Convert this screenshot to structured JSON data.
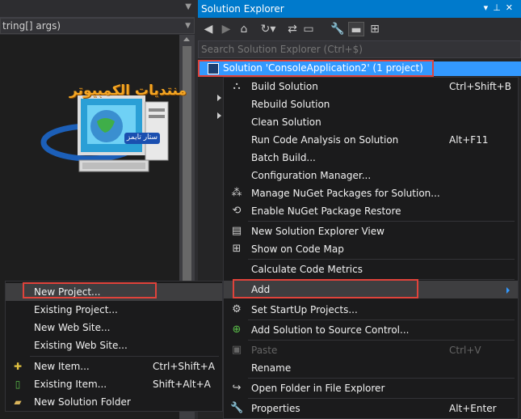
{
  "editor": {
    "nav_text": "tring[] args)"
  },
  "watermark": {
    "arabic_text": "منتديات الكمبيوتر",
    "badge_text": "ستار تايمز"
  },
  "solution_explorer": {
    "title": "Solution Explorer",
    "search_placeholder": "Search Solution Explorer (Ctrl+$)",
    "solution_label": "Solution 'ConsoleApplication2' (1 project)"
  },
  "context_menu": {
    "items": [
      {
        "label": "Build Solution",
        "shortcut": "Ctrl+Shift+B",
        "icon": "build-icon"
      },
      {
        "label": "Rebuild Solution",
        "shortcut": ""
      },
      {
        "label": "Clean Solution",
        "shortcut": ""
      },
      {
        "label": "Run Code Analysis on Solution",
        "shortcut": "Alt+F11"
      },
      {
        "label": "Batch Build...",
        "shortcut": ""
      },
      {
        "label": "Configuration Manager...",
        "shortcut": ""
      },
      {
        "label": "Manage NuGet Packages for Solution...",
        "shortcut": "",
        "icon": "nuget-icon"
      },
      {
        "label": "Enable NuGet Package Restore",
        "shortcut": "",
        "icon": "package-restore-icon"
      },
      {
        "label": "New Solution Explorer View",
        "shortcut": "",
        "icon": "new-view-icon"
      },
      {
        "label": "Show on Code Map",
        "shortcut": "",
        "icon": "code-map-icon"
      },
      {
        "label": "Calculate Code Metrics",
        "shortcut": ""
      },
      {
        "label": "Add",
        "shortcut": ""
      },
      {
        "label": "Set StartUp Projects...",
        "shortcut": "",
        "icon": "gear-icon"
      },
      {
        "label": "Add Solution to Source Control...",
        "shortcut": "",
        "icon": "source-control-icon"
      },
      {
        "label": "Paste",
        "shortcut": "Ctrl+V",
        "icon": "paste-icon",
        "disabled": true
      },
      {
        "label": "Rename",
        "shortcut": ""
      },
      {
        "label": "Open Folder in File Explorer",
        "shortcut": "",
        "icon": "open-folder-icon"
      },
      {
        "label": "Properties",
        "shortcut": "Alt+Enter",
        "icon": "wrench-icon"
      }
    ]
  },
  "add_submenu": {
    "items": [
      {
        "label": "New Project...",
        "shortcut": ""
      },
      {
        "label": "Existing Project...",
        "shortcut": ""
      },
      {
        "label": "New Web Site...",
        "shortcut": ""
      },
      {
        "label": "Existing Web Site...",
        "shortcut": ""
      },
      {
        "label": "New Item...",
        "shortcut": "Ctrl+Shift+A",
        "icon": "new-item-icon"
      },
      {
        "label": "Existing Item...",
        "shortcut": "Shift+Alt+A",
        "icon": "existing-item-icon"
      },
      {
        "label": "New Solution Folder",
        "shortcut": "",
        "icon": "folder-icon"
      }
    ]
  },
  "colors": {
    "accent": "#007acc",
    "selection": "#3399ff",
    "highlight_box": "#e0433b",
    "menu_bg": "#1b1b1c"
  }
}
